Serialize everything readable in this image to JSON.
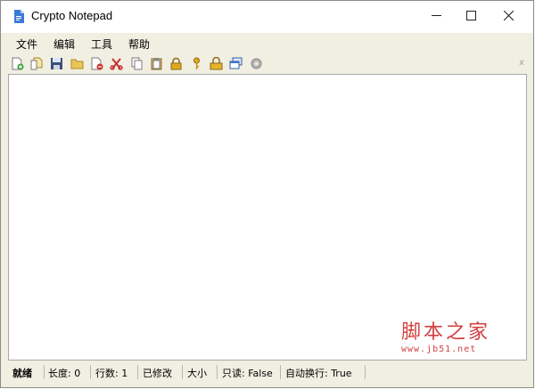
{
  "window": {
    "title": "Crypto Notepad"
  },
  "menu": [
    "文件",
    "编辑",
    "工具",
    "帮助"
  ],
  "toolbar": {
    "icons": [
      "new-file-icon",
      "open-file-icon",
      "save-icon",
      "open-folder-icon",
      "delete-file-icon",
      "cut-icon",
      "copy-icon",
      "paste-icon",
      "lock-icon",
      "key-icon",
      "encrypt-icon",
      "window-icon",
      "settings-icon"
    ],
    "close_label": "x"
  },
  "editor": {
    "content": ""
  },
  "watermark": {
    "text": "脚本之家",
    "url": "www.jb51.net"
  },
  "status": {
    "ready": "就绪",
    "length": "长度: 0",
    "lines": "行数: 1",
    "modified": "已修改",
    "size": "大小",
    "readonly": "只读: False",
    "wordwrap": "自动换行: True"
  },
  "colors": {
    "chrome": "#f1efe2",
    "accent": "#d24040"
  }
}
